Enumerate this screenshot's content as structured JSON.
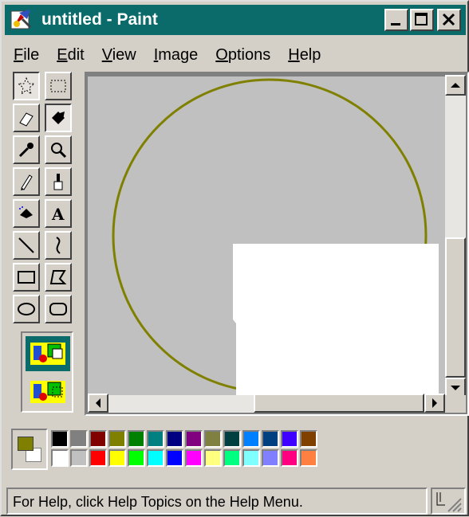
{
  "window": {
    "title": "untitled - Paint",
    "title_bar_color": "#0b6b6b",
    "controls": [
      "minimize-icon",
      "maximize-icon",
      "close-icon"
    ]
  },
  "menu": {
    "items": [
      {
        "key": "F",
        "rest": "ile"
      },
      {
        "key": "E",
        "rest": "dit"
      },
      {
        "key": "V",
        "rest": "iew"
      },
      {
        "key": "I",
        "rest": "mage"
      },
      {
        "key": "O",
        "rest": "ptions"
      },
      {
        "key": "H",
        "rest": "elp"
      }
    ]
  },
  "toolbox": {
    "tools": [
      {
        "name": "free-form-select",
        "icon": "star-select-icon",
        "pressed": true
      },
      {
        "name": "select",
        "icon": "rect-select-icon",
        "pressed": false
      },
      {
        "name": "eraser",
        "icon": "eraser-icon",
        "pressed": false
      },
      {
        "name": "fill-with-color",
        "icon": "paint-bucket-icon",
        "pressed": true
      },
      {
        "name": "pick-color",
        "icon": "eyedropper-icon",
        "pressed": false
      },
      {
        "name": "magnifier",
        "icon": "magnifier-icon",
        "pressed": false
      },
      {
        "name": "pencil",
        "icon": "pencil-icon",
        "pressed": false
      },
      {
        "name": "brush",
        "icon": "brush-icon",
        "pressed": false
      },
      {
        "name": "airbrush",
        "icon": "airbrush-icon",
        "pressed": false
      },
      {
        "name": "text",
        "icon": "text-icon",
        "pressed": false
      },
      {
        "name": "line",
        "icon": "line-icon",
        "pressed": false
      },
      {
        "name": "curve",
        "icon": "curve-icon",
        "pressed": false
      },
      {
        "name": "rectangle",
        "icon": "rectangle-icon",
        "pressed": false
      },
      {
        "name": "polygon",
        "icon": "polygon-icon",
        "pressed": false
      },
      {
        "name": "ellipse",
        "icon": "ellipse-icon",
        "pressed": false
      },
      {
        "name": "rounded-rectangle",
        "icon": "rounded-rectangle-icon",
        "pressed": false
      }
    ],
    "options": [
      "opaque-selection-icon",
      "transparent-selection-icon"
    ],
    "selected_option": 0
  },
  "canvas": {
    "background": "#c0c0c0",
    "circle_color": "#808000",
    "selection_fill": "#ffffff"
  },
  "palette": {
    "foreground": "#808000",
    "background": "#ffffff",
    "top_row": [
      "#000000",
      "#808080",
      "#800000",
      "#808000",
      "#008000",
      "#008080",
      "#000080",
      "#800080",
      "#808040",
      "#004040",
      "#0080ff",
      "#004080",
      "#4000ff",
      "#804000"
    ],
    "bottom_row": [
      "#ffffff",
      "#c0c0c0",
      "#ff0000",
      "#ffff00",
      "#00ff00",
      "#00ffff",
      "#0000ff",
      "#ff00ff",
      "#ffff80",
      "#00ff80",
      "#80ffff",
      "#8080ff",
      "#ff0080",
      "#ff8040"
    ]
  },
  "status": {
    "text": "For Help, click Help Topics on the Help Menu."
  }
}
